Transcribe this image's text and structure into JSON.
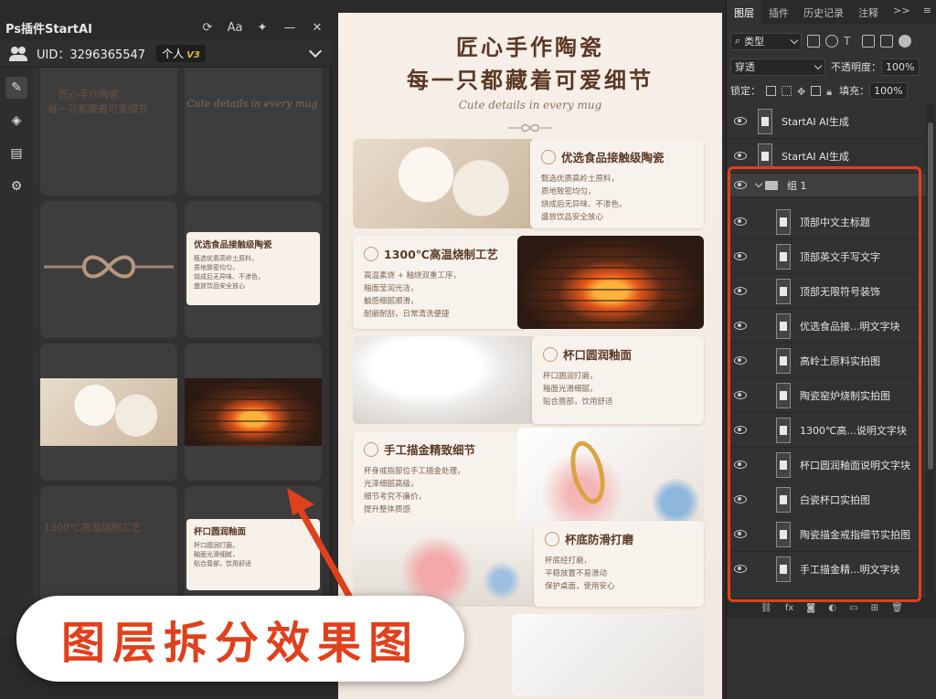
{
  "plugin": {
    "title": "Ps插件StartAI",
    "uid_label": "UID：3296365547",
    "plan": "个人",
    "plan_version": "V3",
    "thumbs": {
      "faint_title_1": "匠心手作陶瓷",
      "faint_title_2": "每一只都藏着可爱细节",
      "script_text": "Cute details in every mug",
      "card1_title": "优选食品接触级陶瓷",
      "card1_lines": [
        "甄选优质高岭土原料，",
        "质地致密均匀，",
        "烧成后无异味、不渗色，",
        "盛放饮品安全放心"
      ],
      "faint_kiln_title": "1300℃高温烧制工艺",
      "card2_title": "杯口圆润釉面",
      "card2_lines": [
        "杯口圆润打磨，",
        "釉面光滑细腻，",
        "贴合唇部，饮用舒适"
      ]
    }
  },
  "canvas": {
    "title_line1": "匠心手作陶瓷",
    "title_line2": "每一只都藏着可爱细节",
    "subtitle": "Cute details in every mug",
    "features": [
      {
        "title": "优选食品接触级陶瓷",
        "lines": [
          "甄选优质高岭土原料，",
          "质地致密均匀，",
          "烧成后无异味、不渗色，",
          "盛放饮品安全放心"
        ]
      },
      {
        "title": "1300℃高温烧制工艺",
        "lines": [
          "高温素烧 + 釉烧双重工序，",
          "釉面莹润光洁，",
          "触感细腻顺滑，",
          "耐磨耐刮，日常清洗便捷"
        ]
      },
      {
        "title": "杯口圆润釉面",
        "lines": [
          "杯口圆润打磨，",
          "釉面光滑细腻，",
          "贴合唇部，饮用舒适"
        ]
      },
      {
        "title": "手工描金精致细节",
        "lines": [
          "杯身戒指部位手工描金处理，",
          "光泽细腻高级，",
          "细节考究不廉价，",
          "提升整体质感"
        ]
      },
      {
        "title": "杯底防滑打磨",
        "lines": [
          "杯底经打磨，",
          "平稳放置不易滑动",
          "保护桌面，使用安心"
        ]
      }
    ]
  },
  "layers_panel": {
    "tabs": [
      "图层",
      "插件",
      "历史记录",
      "注释"
    ],
    "more": ">>",
    "filter_kind": "类型",
    "blend_mode": "穿透",
    "opacity_label": "不透明度：",
    "opacity_value": "100%",
    "lock_label": "锁定：",
    "fill_label": "填充：",
    "fill_value": "100%",
    "layers": [
      {
        "name": "StartAI AI生成",
        "type": "layer"
      },
      {
        "name": "StartAI AI生成",
        "type": "layer"
      },
      {
        "name": "组 1",
        "type": "group"
      },
      {
        "name": "顶部中文主标题",
        "type": "child"
      },
      {
        "name": "顶部英文手写文字",
        "type": "child"
      },
      {
        "name": "顶部无限符号装饰",
        "type": "child"
      },
      {
        "name": "优选食品接...明文字块",
        "type": "child"
      },
      {
        "name": "高岭土原料实拍图",
        "type": "child"
      },
      {
        "name": "陶瓷窑炉烧制实拍图",
        "type": "child"
      },
      {
        "name": "1300℃高...说明文字块",
        "type": "child"
      },
      {
        "name": "杯口圆润釉面说明文字块",
        "type": "child"
      },
      {
        "name": "白瓷杯口实拍图",
        "type": "child"
      },
      {
        "name": "陶瓷描金戒指细节实拍图",
        "type": "child"
      },
      {
        "name": "手工描金精...明文字块",
        "type": "child"
      }
    ]
  },
  "overlay_label": "图层拆分效果图",
  "colors": {
    "accent_red": "#e0401c",
    "brown_title": "#5a3824",
    "gold_v3": "#e4b341"
  }
}
